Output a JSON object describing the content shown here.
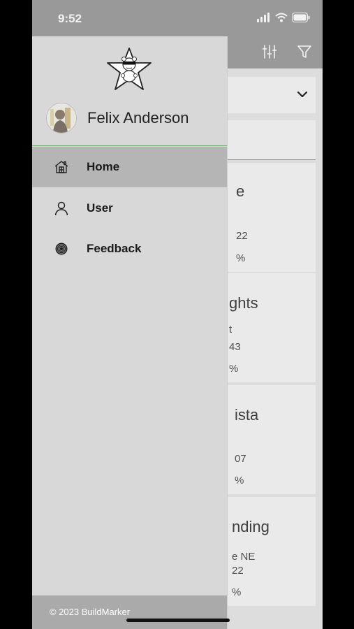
{
  "status_bar": {
    "time": "9:52"
  },
  "header": {
    "filter_settings_icon": "sliders-icon",
    "filter_icon": "filter-icon",
    "background_color": "#a2a2a2"
  },
  "background_list": {
    "cards": [
      {
        "title": "e",
        "line1": "",
        "line2": "22",
        "pct": "%"
      },
      {
        "title": "ghts",
        "line1": "t",
        "line2": "43",
        "pct": "%"
      },
      {
        "title": "ista",
        "line1": "",
        "line2": "07",
        "pct": "%"
      },
      {
        "title": "nding",
        "line1": "e NE",
        "line2": "22",
        "pct": "%"
      }
    ]
  },
  "drawer": {
    "user_name": "Felix Anderson",
    "nav": [
      {
        "label": "Home",
        "icon": "home-icon",
        "active": true
      },
      {
        "label": "User",
        "icon": "user-icon",
        "active": false
      },
      {
        "label": "Feedback",
        "icon": "feedback-icon",
        "active": false
      }
    ],
    "footer": "© 2023 BuildMarker",
    "accent": "#6fae6f"
  }
}
